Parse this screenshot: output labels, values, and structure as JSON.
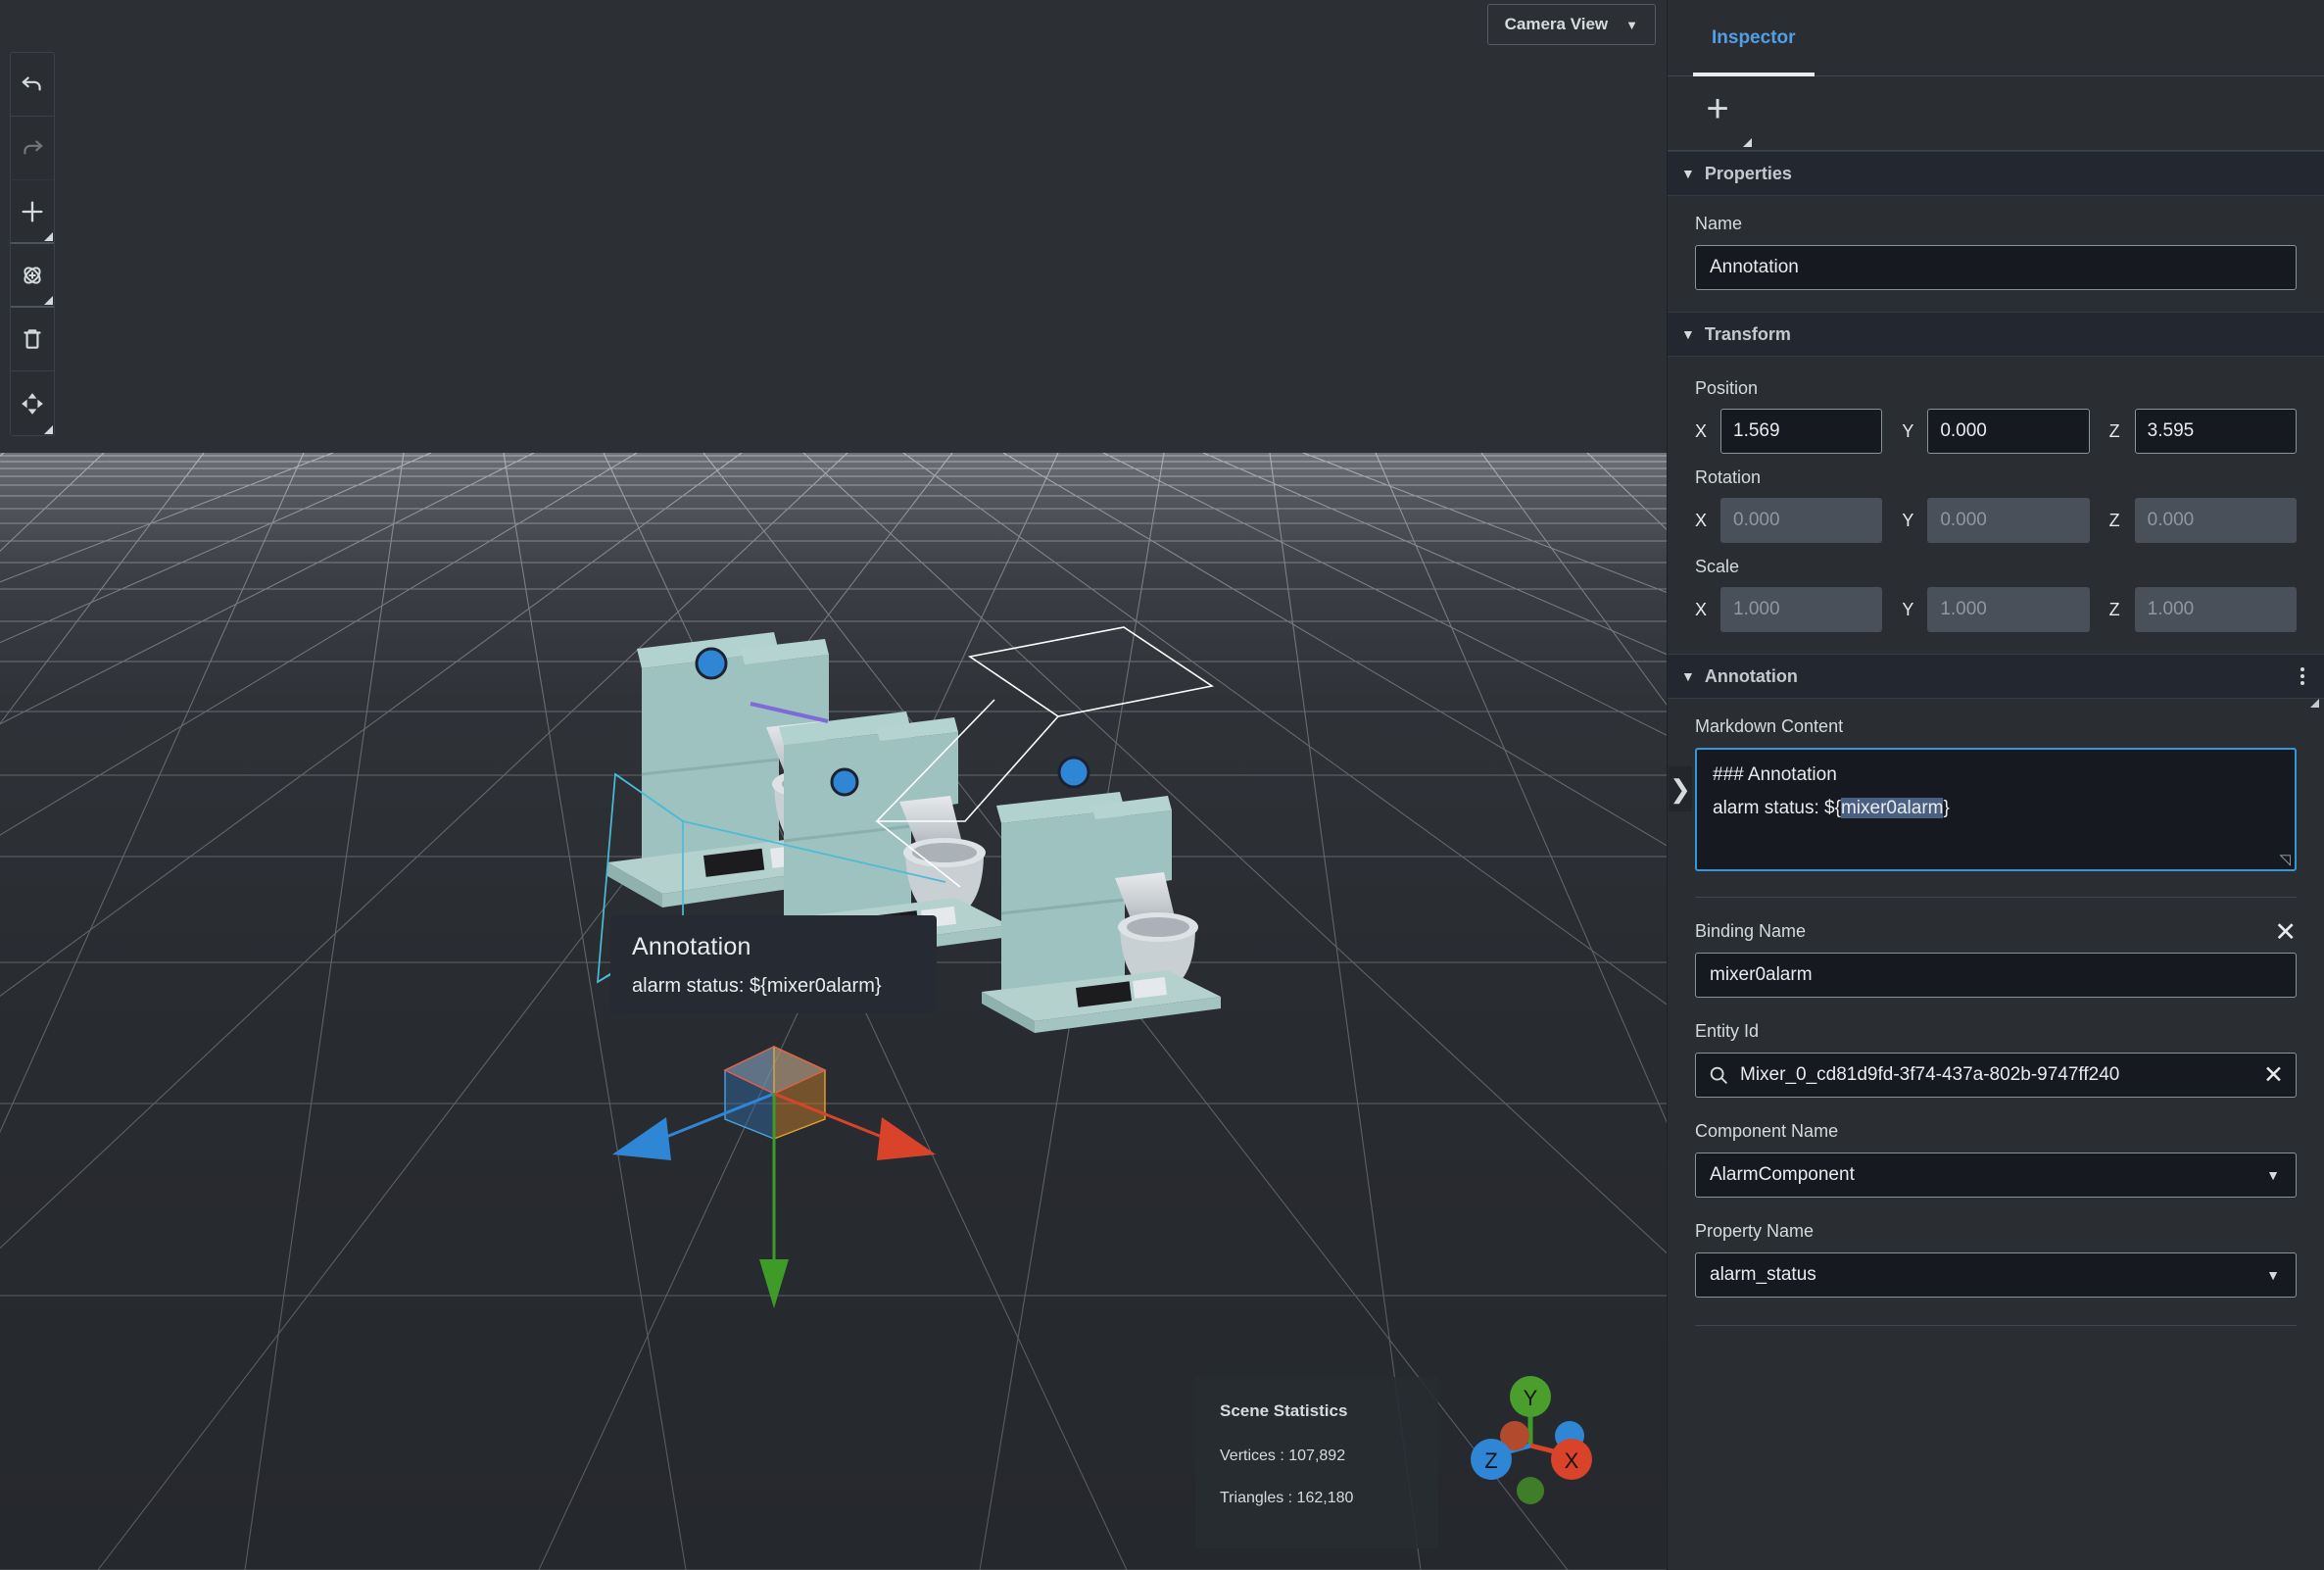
{
  "viewport": {
    "camera_view_label": "Camera View",
    "camera_view_caret": "▼",
    "toolbar": [
      {
        "name": "undo",
        "icon": "undo-icon",
        "enabled": true
      },
      {
        "name": "redo",
        "icon": "redo-icon",
        "enabled": false
      },
      {
        "name": "add-object",
        "icon": "plus-icon",
        "enabled": true
      },
      {
        "name": "rotate",
        "icon": "orbit-icon",
        "enabled": true
      },
      {
        "name": "delete",
        "icon": "trash-icon",
        "enabled": true
      },
      {
        "name": "translate",
        "icon": "move-icon",
        "enabled": true
      }
    ],
    "annotation_overlay": {
      "title": "Annotation",
      "subtitle": "alarm status: ${mixer0alarm}"
    },
    "scene_statistics": {
      "title": "Scene Statistics",
      "vertices": "Vertices : 107,892",
      "triangles": "Triangles : 162,180"
    },
    "axis_gizmo": {
      "x_label": "X",
      "y_label": "Y",
      "z_label": "Z",
      "x_color": "#d8432a",
      "y_color": "#3f9b28",
      "z_color": "#2f86d4"
    },
    "collapse_chevron": "❯"
  },
  "inspector": {
    "tab_label": "Inspector",
    "add_button_icon": "plus-icon",
    "sections": {
      "properties": {
        "title": "Properties",
        "triangle": "▼",
        "name_label": "Name",
        "name_value": "Annotation"
      },
      "transform": {
        "title": "Transform",
        "triangle": "▼",
        "position_label": "Position",
        "rotation_label": "Rotation",
        "scale_label": "Scale",
        "axes": [
          "X",
          "Y",
          "Z"
        ],
        "position": {
          "x": "1.569",
          "y": "0.000",
          "z": "3.595"
        },
        "rotation": {
          "x": "0.000",
          "y": "0.000",
          "z": "0.000"
        },
        "scale": {
          "x": "1.000",
          "y": "1.000",
          "z": "1.000"
        }
      },
      "annotation": {
        "title": "Annotation",
        "triangle": "▼",
        "kebab_icon": "more-vertical-icon",
        "markdown_label": "Markdown Content",
        "markdown_line1": "### Annotation",
        "markdown_line2_pre": "alarm status: ${",
        "markdown_line2_highlight": "mixer0alarm",
        "markdown_line2_post": "}",
        "binding_name_label": "Binding Name",
        "binding_name_clear": "✕",
        "binding_name_value": "mixer0alarm",
        "entity_id_label": "Entity Id",
        "entity_id_value": "Mixer_0_cd81d9fd-3f74-437a-802b-9747ff240",
        "entity_id_clear": "✕",
        "entity_id_search_icon": "search-icon",
        "component_name_label": "Component Name",
        "component_name_value": "AlarmComponent",
        "component_name_caret": "▼",
        "property_name_label": "Property Name",
        "property_name_value": "alarm_status",
        "property_name_caret": "▼"
      }
    }
  },
  "colors": {
    "accent_blue": "#539fe5",
    "focus_blue": "#3596d8",
    "panel_bg": "#2a2e33",
    "input_bg": "#16191f",
    "viewport_bg": "#2c3034",
    "selection_cyan": "#4bbbd8",
    "mixer_body": "#9cc3c0"
  }
}
